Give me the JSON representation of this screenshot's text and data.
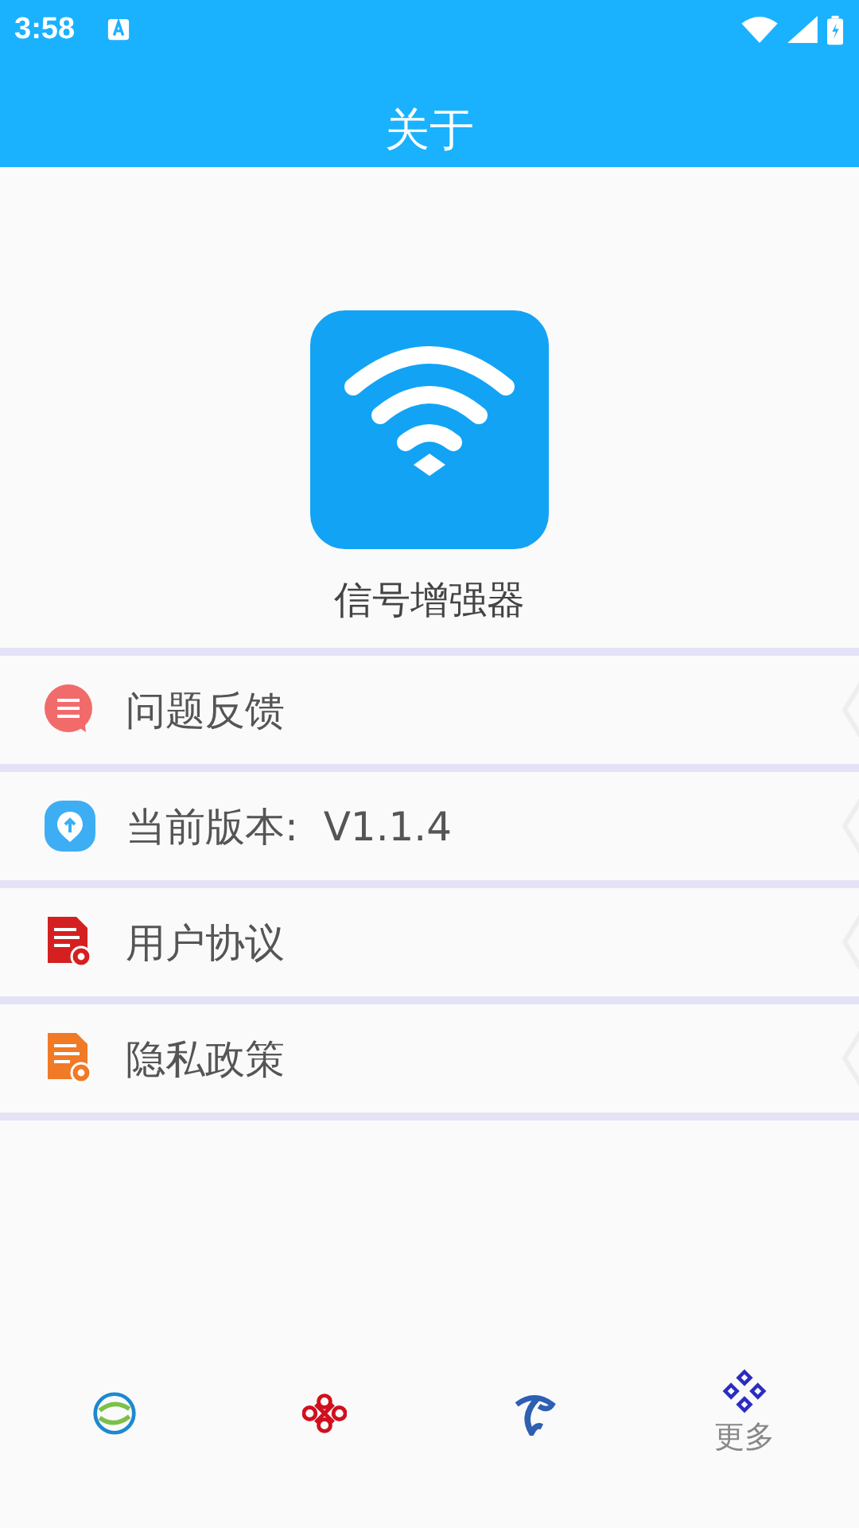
{
  "status_bar": {
    "time": "3:58"
  },
  "header": {
    "title": "关于"
  },
  "app": {
    "name": "信号增强器"
  },
  "menu": [
    {
      "kind": "feedback",
      "label": "问题反馈"
    },
    {
      "kind": "version",
      "label": "当前版本:  V1.1.4"
    },
    {
      "kind": "agreement",
      "label": "用户协议"
    },
    {
      "kind": "privacy",
      "label": "隐私政策"
    }
  ],
  "bottom_nav": [
    {
      "kind": "rings"
    },
    {
      "kind": "knot"
    },
    {
      "kind": "swirl"
    },
    {
      "kind": "grid",
      "label": "更多"
    }
  ]
}
